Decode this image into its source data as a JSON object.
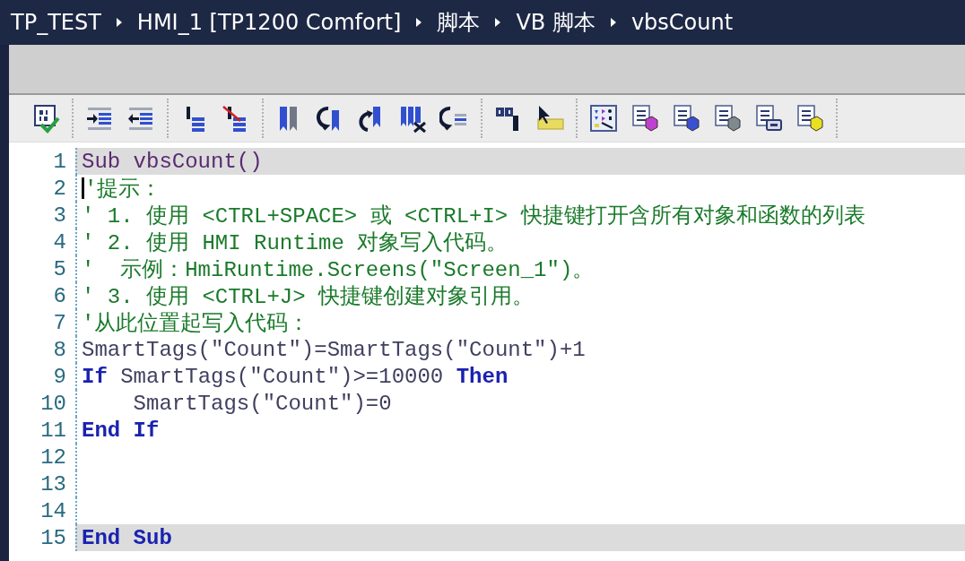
{
  "breadcrumb": [
    {
      "text": "TP_TEST"
    },
    {
      "text": "HMI_1 [TP1200 Comfort]"
    },
    {
      "text": "脚本"
    },
    {
      "text": "VB 脚本"
    },
    {
      "text": "vbsCount"
    }
  ],
  "editor": {
    "lines": [
      {
        "number": "1",
        "highlighted": true,
        "cursor": false,
        "tokens": [
          {
            "kind": "declaration",
            "text": "Sub vbsCount()"
          }
        ]
      },
      {
        "number": "2",
        "highlighted": false,
        "cursor": true,
        "tokens": [
          {
            "kind": "comment",
            "text": "'提示："
          }
        ]
      },
      {
        "number": "3",
        "highlighted": false,
        "cursor": false,
        "tokens": [
          {
            "kind": "comment",
            "text": "' 1. 使用 <CTRL+SPACE> 或 <CTRL+I> 快捷键打开含所有对象和函数的列表"
          }
        ]
      },
      {
        "number": "4",
        "highlighted": false,
        "cursor": false,
        "tokens": [
          {
            "kind": "comment",
            "text": "' 2. 使用 HMI Runtime 对象写入代码。"
          }
        ]
      },
      {
        "number": "5",
        "highlighted": false,
        "cursor": false,
        "tokens": [
          {
            "kind": "comment",
            "text": "'  示例：HmiRuntime.Screens(\"Screen_1\")。"
          }
        ]
      },
      {
        "number": "6",
        "highlighted": false,
        "cursor": false,
        "tokens": [
          {
            "kind": "comment",
            "text": "' 3. 使用 <CTRL+J> 快捷键创建对象引用。"
          }
        ]
      },
      {
        "number": "7",
        "highlighted": false,
        "cursor": false,
        "tokens": [
          {
            "kind": "comment",
            "text": "'从此位置起写入代码："
          }
        ]
      },
      {
        "number": "8",
        "highlighted": false,
        "cursor": false,
        "tokens": [
          {
            "kind": "plain",
            "text": "SmartTags(\"Count\")=SmartTags(\"Count\")+1"
          }
        ]
      },
      {
        "number": "9",
        "highlighted": false,
        "cursor": false,
        "tokens": [
          {
            "kind": "keyword",
            "text": "If"
          },
          {
            "kind": "plain",
            "text": " SmartTags(\"Count\")>=10000 "
          },
          {
            "kind": "keyword",
            "text": "Then"
          }
        ]
      },
      {
        "number": "10",
        "highlighted": false,
        "cursor": false,
        "tokens": [
          {
            "kind": "plain",
            "text": "    SmartTags(\"Count\")=0"
          }
        ]
      },
      {
        "number": "11",
        "highlighted": false,
        "cursor": false,
        "tokens": [
          {
            "kind": "keyword",
            "text": "End If"
          }
        ]
      },
      {
        "number": "12",
        "highlighted": false,
        "cursor": false
      },
      {
        "number": "13",
        "highlighted": false,
        "cursor": false
      },
      {
        "number": "14",
        "highlighted": false,
        "cursor": false
      },
      {
        "number": "15",
        "highlighted": true,
        "cursor": false,
        "tokens": [
          {
            "kind": "keyword",
            "text": "End Sub"
          }
        ]
      }
    ]
  }
}
